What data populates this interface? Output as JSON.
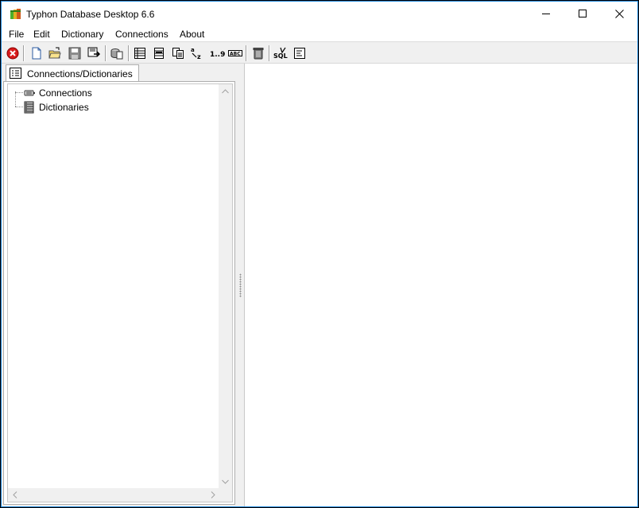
{
  "window": {
    "title": "Typhon Database Desktop 6.6",
    "border_color": "#1883d7"
  },
  "menu": {
    "items": [
      "File",
      "Edit",
      "Dictionary",
      "Connections",
      "About"
    ]
  },
  "toolbar": {
    "buttons": [
      "close-red-icon",
      "new-document-icon",
      "open-folder-icon",
      "save-icon",
      "save-export-icon",
      "database-icon",
      "table-icon",
      "columns-icon",
      "copy-icon",
      "sort-az-icon",
      "numbering-icon",
      "abc-field-icon",
      "trash-icon",
      "sql-icon",
      "properties-icon"
    ]
  },
  "left_panel": {
    "tab_label": "Connections/Dictionaries",
    "tree": [
      {
        "label": "Connections",
        "icon": "connection-icon"
      },
      {
        "label": "Dictionaries",
        "icon": "dictionary-icon"
      }
    ]
  }
}
